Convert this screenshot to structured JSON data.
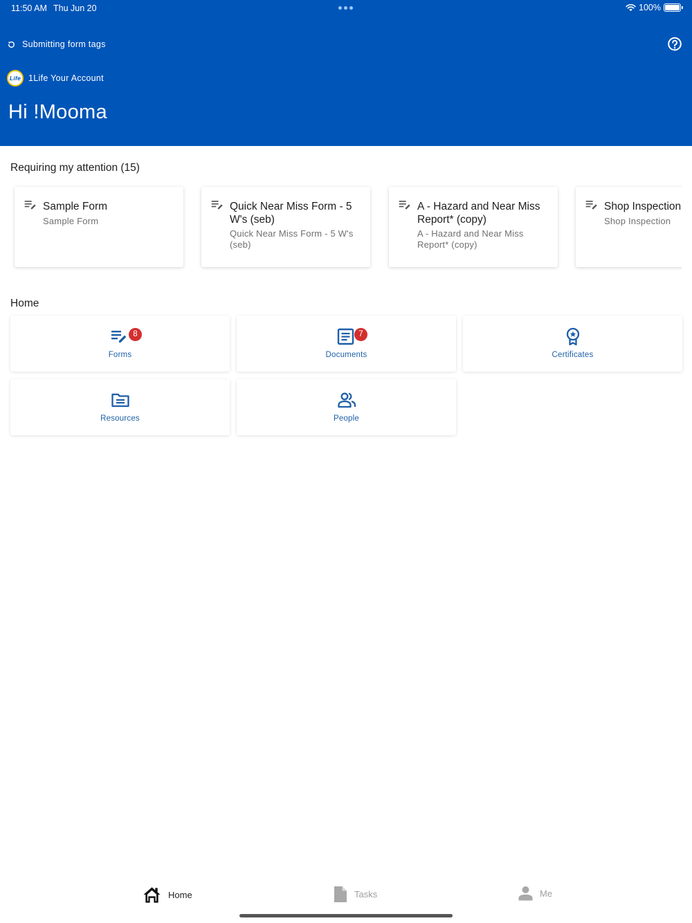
{
  "status_bar": {
    "time": "11:50 AM",
    "date": "Thu Jun 20",
    "battery": "100%"
  },
  "header": {
    "sync_status": "Submitting form tags",
    "logo_text": "Life",
    "account_name": "1Life Your Account",
    "greeting": "Hi !Mooma"
  },
  "attention": {
    "title": "Requiring my attention (15)",
    "cards": [
      {
        "title": "Sample Form",
        "subtitle": "Sample Form"
      },
      {
        "title": "Quick Near Miss Form - 5 W's (seb)",
        "subtitle": "Quick Near Miss Form - 5 W's (seb)"
      },
      {
        "title": "A - Hazard and Near Miss Report* (copy)",
        "subtitle": "A - Hazard and Near Miss Report* (copy)"
      },
      {
        "title": "Shop Inspection",
        "subtitle": "Shop Inspection"
      }
    ]
  },
  "home": {
    "title": "Home",
    "tiles": [
      {
        "label": "Forms",
        "icon": "form-edit-icon",
        "badge": "8"
      },
      {
        "label": "Documents",
        "icon": "document-icon",
        "badge": "7"
      },
      {
        "label": "Certificates",
        "icon": "certificate-icon",
        "badge": ""
      },
      {
        "label": "Resources",
        "icon": "folder-icon",
        "badge": ""
      },
      {
        "label": "People",
        "icon": "people-icon",
        "badge": ""
      }
    ]
  },
  "bottom_nav": {
    "home": "Home",
    "tasks": "Tasks",
    "me": "Me"
  },
  "colors": {
    "header_bg": "#0055b8",
    "accent": "#1e5fa8",
    "badge": "#d32f2f"
  }
}
